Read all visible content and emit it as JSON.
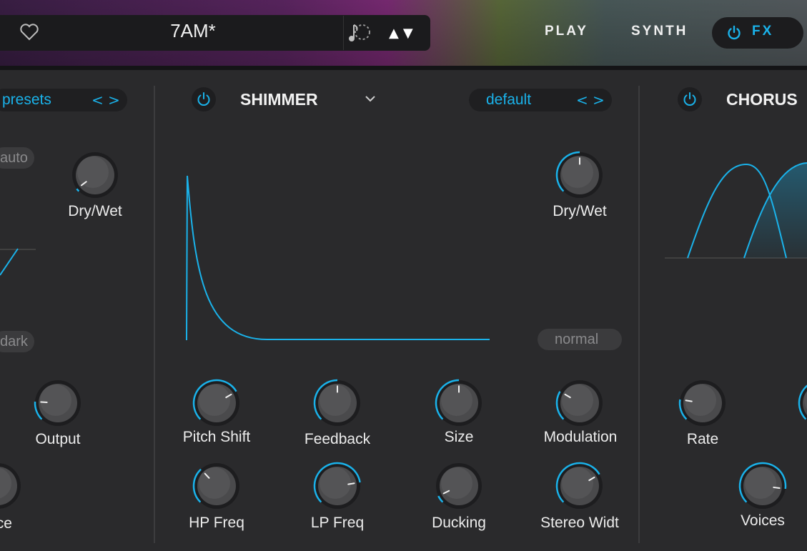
{
  "header": {
    "preset_name": "7AM*",
    "tabs": [
      "PLAY",
      "SYNTH",
      "FX"
    ],
    "active_tab": "FX",
    "arrows": "▲▼"
  },
  "left_panel": {
    "preset_selector": "presets",
    "mode_auto": "auto",
    "mode_dark": "dark",
    "knobs": {
      "dry_wet": "Dry/Wet",
      "output": "Output",
      "partial_label": "nce"
    }
  },
  "shimmer": {
    "title": "SHIMMER",
    "preset": "default",
    "mode": "normal",
    "knobs": {
      "dry_wet": "Dry/Wet",
      "pitch_shift": "Pitch Shift",
      "feedback": "Feedback",
      "size": "Size",
      "modulation": "Modulation",
      "hp_freq": "HP Freq",
      "lp_freq": "LP Freq",
      "ducking": "Ducking",
      "stereo_width": "Stereo Widt"
    }
  },
  "chorus": {
    "title": "CHORUS",
    "knobs": {
      "rate": "Rate",
      "voices": "Voices"
    }
  },
  "colors": {
    "accent": "#1ab2ea",
    "panel": "#2a2a2c"
  }
}
